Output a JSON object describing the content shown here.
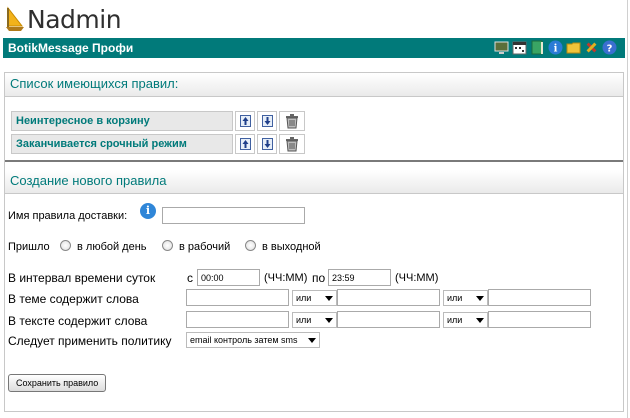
{
  "app": {
    "logo_text": "Nadmin",
    "title": "BotikMessage Профи"
  },
  "toolbar_icons": [
    "monitor-icon",
    "calendar-icon",
    "book-icon",
    "info-icon",
    "folder-icon",
    "tools-icon",
    "help-icon"
  ],
  "rules_section": {
    "heading": "Список имеющихся правил:",
    "rules": [
      {
        "name": "Неинтересное в корзину"
      },
      {
        "name": "Заканчивается срочный режим"
      }
    ]
  },
  "new_rule_section": {
    "heading": "Создание нового правила",
    "name_label": "Имя правила доставки:",
    "name_value": "",
    "arrived_label": "Пришло",
    "day_options": [
      "в любой день",
      "в рабочий",
      "в выходной"
    ],
    "interval_label": "В интервал времени суток",
    "from_label": "с",
    "from_value": "00:00",
    "from_hint": "(ЧЧ:ММ)",
    "to_label": "по",
    "to_value": "23:59",
    "to_hint": "(ЧЧ:ММ)",
    "subject_label": "В теме содержит слова",
    "body_label": "В тексте содержит слова",
    "or_option": "или",
    "policy_label": "Следует применить политику",
    "policy_value": "email контроль затем sms",
    "save_label": "Сохранить правило"
  },
  "colors": {
    "accent": "#017a7a",
    "header_bg": "#017a7a"
  }
}
